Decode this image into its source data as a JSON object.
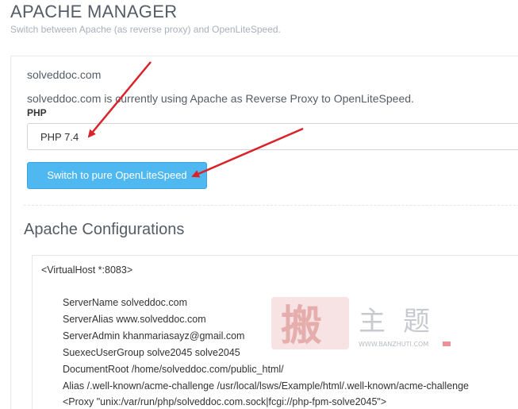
{
  "header": {
    "title": "APACHE MANAGER",
    "subtitle": "Switch between Apache (as reverse proxy) and OpenLiteSpeed."
  },
  "site": {
    "domain": "solveddoc.com",
    "status": "solveddoc.com is currently using Apache as Reverse Proxy to OpenLiteSpeed.",
    "php_label": "PHP",
    "php_selected": "PHP 7.4",
    "switch_label": "Switch to pure OpenLiteSpeed"
  },
  "config": {
    "heading": "Apache Configurations",
    "lines": [
      "<VirtualHost *:8083>",
      "ServerName solveddoc.com",
      "ServerAlias www.solveddoc.com",
      "ServerAdmin khanmariasayz@gmail.com",
      "SuexecUserGroup solve2045 solve2045",
      "DocumentRoot /home/solveddoc.com/public_html/",
      "Alias /.well-known/acme-challenge /usr/local/lsws/Example/html/.well-known/acme-challenge",
      "<Proxy \"unix:/var/run/php/solveddoc.com.sock|fcgi://php-fpm-solve2045\">"
    ]
  },
  "watermark": {
    "text": "搬主题",
    "url": "WWW.BANZHUTI.COM"
  },
  "colors": {
    "accent": "#4fb8f0",
    "annotation_arrow": "#d9232a"
  }
}
